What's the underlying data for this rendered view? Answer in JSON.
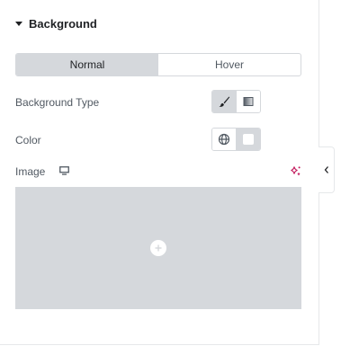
{
  "section": {
    "title": "Background",
    "caret_icon": "caret-down-icon"
  },
  "tabs": [
    {
      "label": "Normal",
      "active": true
    },
    {
      "label": "Hover",
      "active": false
    }
  ],
  "background_type": {
    "label": "Background Type",
    "options": [
      {
        "icon": "brush-icon",
        "active": true
      },
      {
        "icon": "gradient-icon",
        "active": false
      }
    ]
  },
  "color": {
    "label": "Color",
    "options": [
      {
        "icon": "globe-icon",
        "active": false
      },
      {
        "icon": "color-swatch-icon",
        "active": true
      }
    ]
  },
  "image": {
    "label": "Image",
    "device_icon": "desktop-icon",
    "ai_icon": "ai-sparkle-icon",
    "placeholder_icon": "plus-circle-icon"
  },
  "colors": {
    "accent_ai": "#c2185b",
    "tab_active_bg": "#d5d8dc",
    "placeholder_bg": "#d5d8dc"
  },
  "collapse_icon": "chevron-left-icon"
}
